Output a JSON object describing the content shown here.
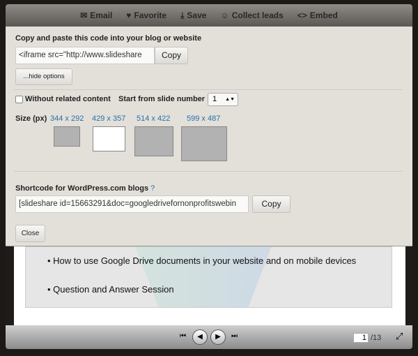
{
  "toolbar": {
    "email": "Email",
    "favorite": "Favorite",
    "save": "Save",
    "collect_leads": "Collect leads",
    "embed": "Embed"
  },
  "embed": {
    "heading": "Copy and paste this code into your blog or website",
    "code": "<iframe src=\"http://www.slideshare",
    "copy": "Copy",
    "hide_options": "...hide options"
  },
  "options": {
    "without_related": "Without related content",
    "without_related_checked": false,
    "start_slide_label": "Start from slide number",
    "start_slide_value": "1"
  },
  "size": {
    "label": "Size (px)",
    "options": [
      "344 x 292",
      "429 x 357",
      "514 x 422",
      "599 x 487"
    ],
    "selected": "429 x 357"
  },
  "shortcode": {
    "label": "Shortcode for WordPress.com blogs",
    "help": "?",
    "code": "[slideshare id=15663291&doc=googledrivefornonprofitswebin",
    "copy": "Copy"
  },
  "close": "Close",
  "slide": {
    "bullets": [
      "How to use Google Drive documents in your website and on mobile devices",
      "Question and Answer Session"
    ]
  },
  "player": {
    "current_page": "1",
    "total": "/13"
  }
}
